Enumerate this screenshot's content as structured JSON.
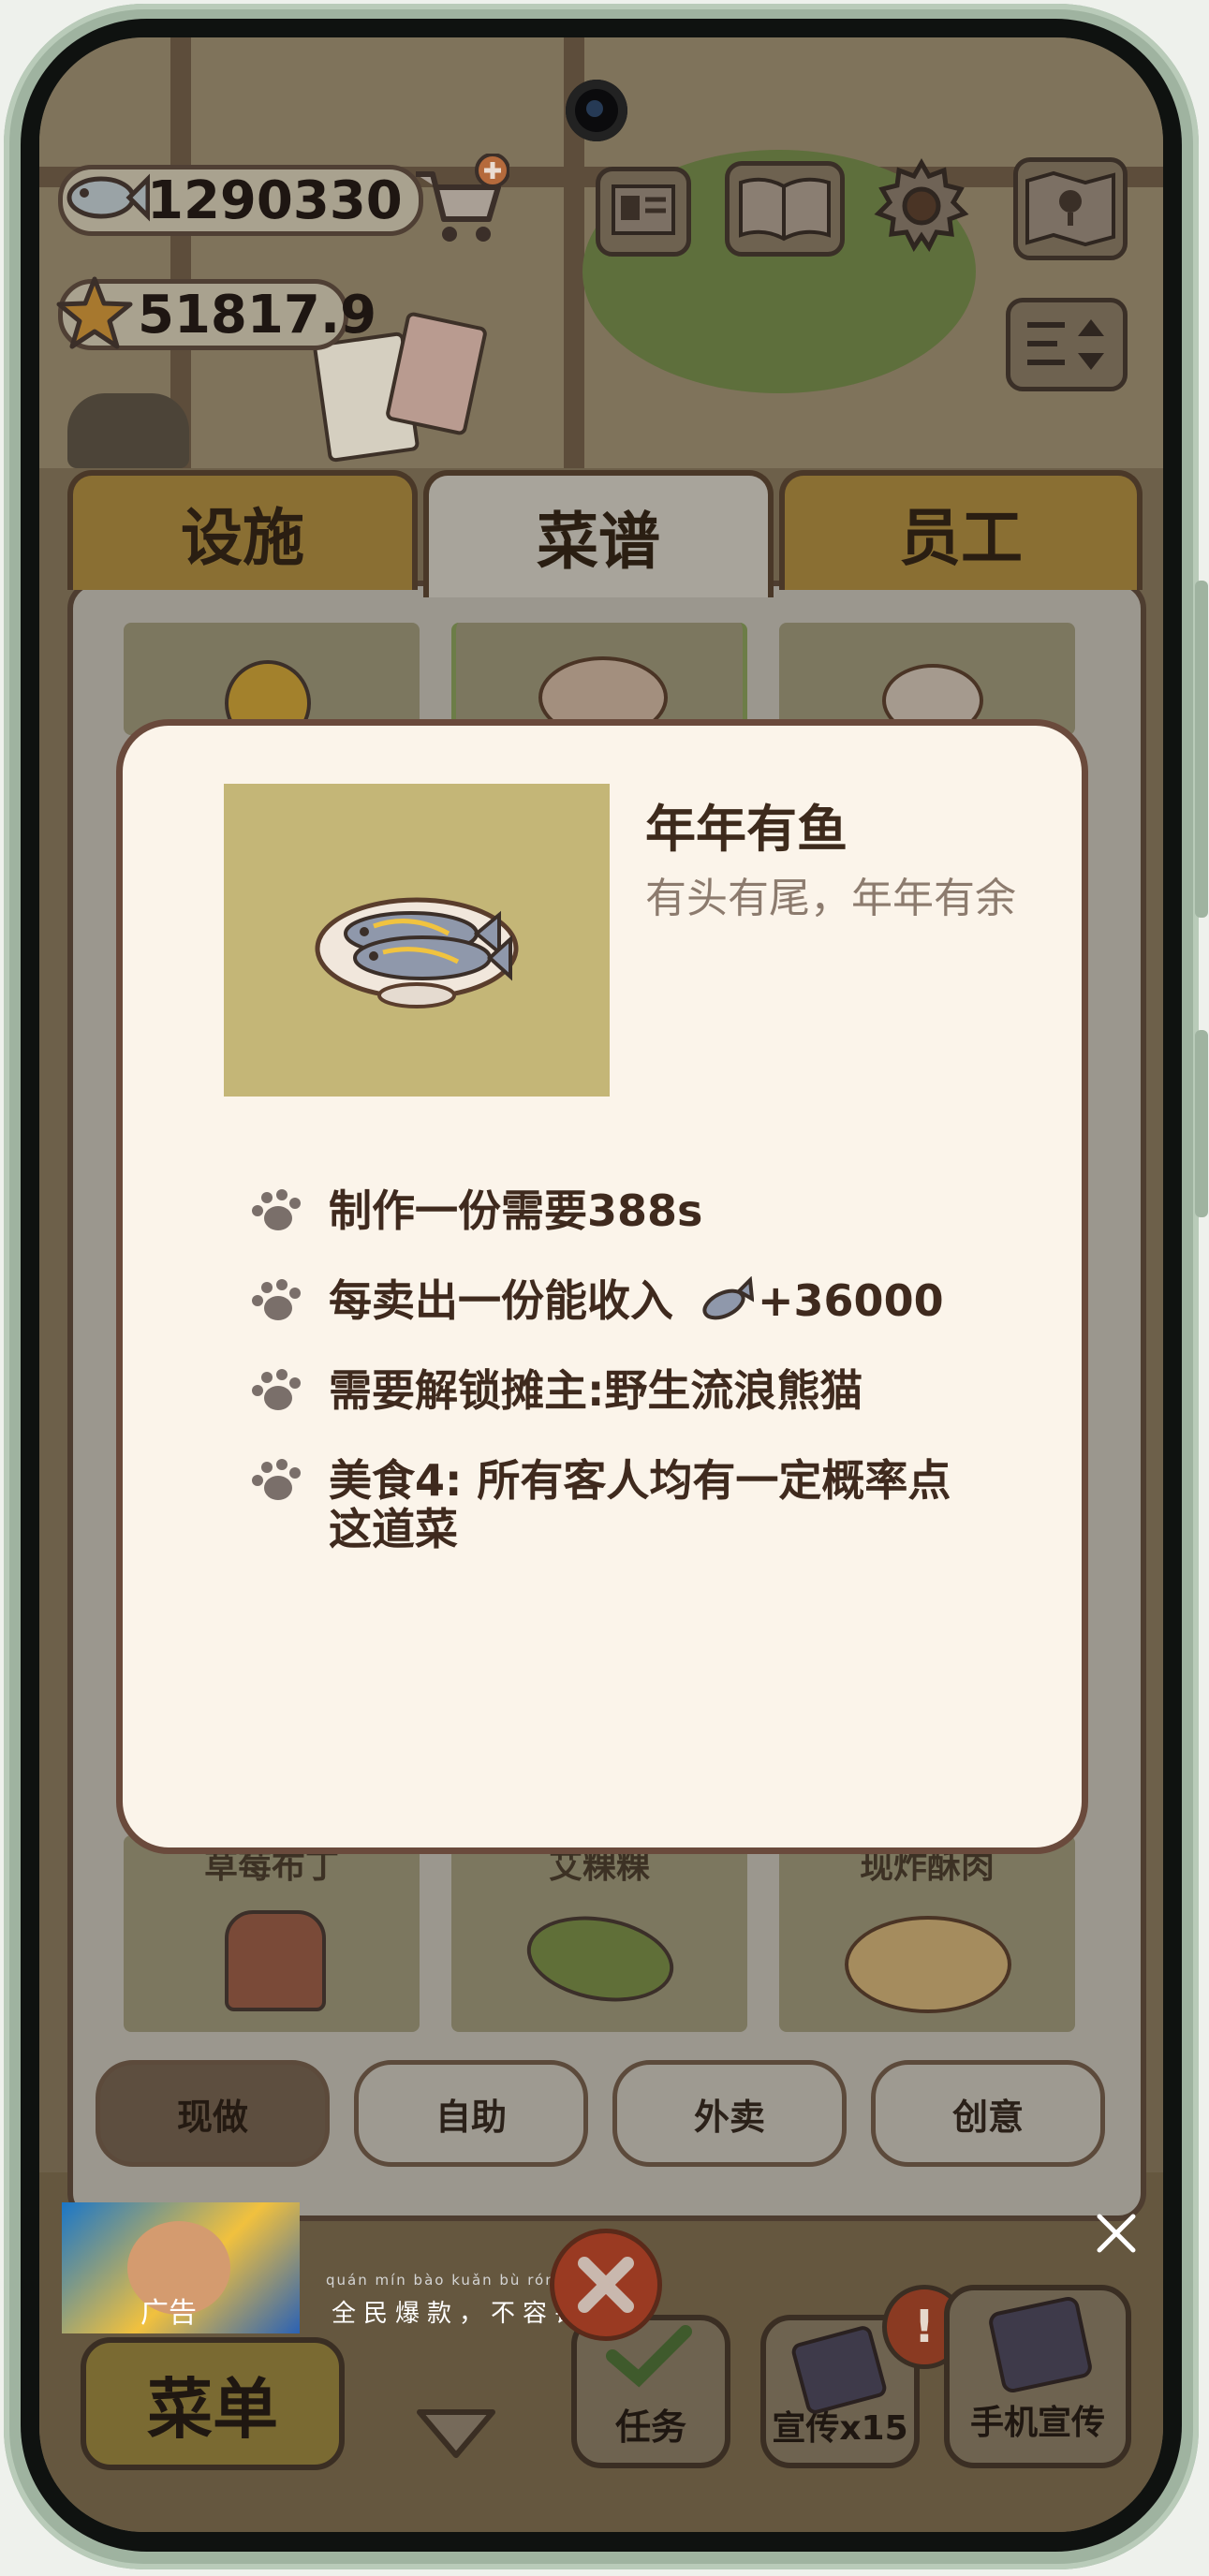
{
  "hud": {
    "fish_currency": "1290330",
    "star_currency": "51817.9"
  },
  "tabs": [
    {
      "label": "设施",
      "active": false
    },
    {
      "label": "菜谱",
      "active": true
    },
    {
      "label": "员工",
      "active": false
    }
  ],
  "recipe_grid": {
    "bottom_labels": [
      "草莓布丁",
      "艾粿粿",
      "现炸酥肉"
    ]
  },
  "dish_detail": {
    "name": "年年有鱼",
    "description": "有头有尾，年年有余",
    "craft_time": "制作一份需要388s",
    "income_prefix": "每卖出一份能收入",
    "income_value": "+36000",
    "unlock_requirement": "需要解锁摊主:野生流浪熊猫",
    "effect_line1": "美食4: 所有客人均有一定概率点",
    "effect_line2": "这道菜"
  },
  "filters": [
    {
      "label": "现做",
      "active": true
    },
    {
      "label": "自助",
      "active": false
    },
    {
      "label": "外卖",
      "active": false
    },
    {
      "label": "创意",
      "active": false
    }
  ],
  "ad": {
    "tag": "广告",
    "text": "全民爆款，不容错过！",
    "pinyin": "quán mín  bào kuǎn     bù  róng  cuò  guò"
  },
  "bottom_bar": {
    "menu_label": "菜单",
    "task_label": "任务",
    "promo_label": "宣传x15",
    "phone_promo_label": "手机宣传"
  },
  "colors": {
    "modal_bg": "#fbf4ea",
    "modal_border": "#6a4a3c",
    "active_tab": "#a8a49b",
    "inactive_tab": "#8a6f33",
    "dish_tile": "#c4b677"
  }
}
